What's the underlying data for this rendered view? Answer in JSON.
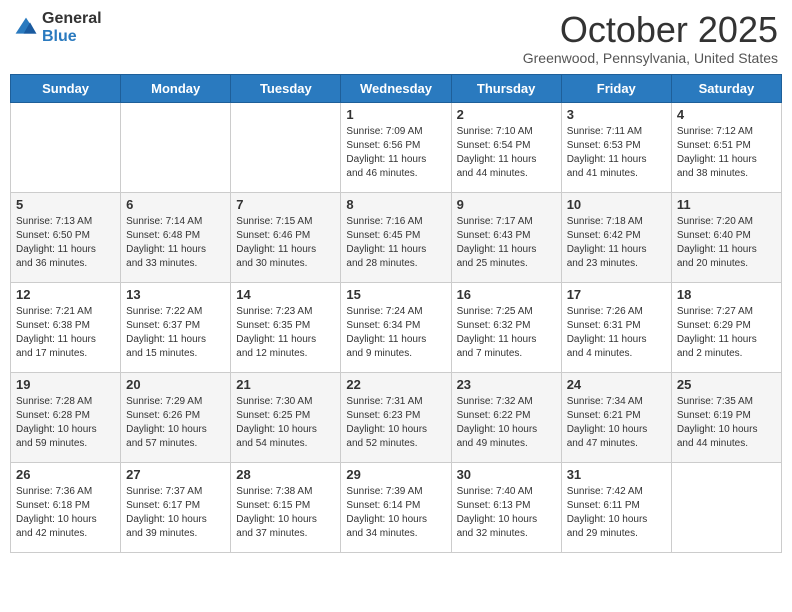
{
  "logo": {
    "general": "General",
    "blue": "Blue"
  },
  "header": {
    "title": "October 2025",
    "subtitle": "Greenwood, Pennsylvania, United States"
  },
  "days_of_week": [
    "Sunday",
    "Monday",
    "Tuesday",
    "Wednesday",
    "Thursday",
    "Friday",
    "Saturday"
  ],
  "weeks": [
    [
      {
        "day": "",
        "info": ""
      },
      {
        "day": "",
        "info": ""
      },
      {
        "day": "",
        "info": ""
      },
      {
        "day": "1",
        "info": "Sunrise: 7:09 AM\nSunset: 6:56 PM\nDaylight: 11 hours and 46 minutes."
      },
      {
        "day": "2",
        "info": "Sunrise: 7:10 AM\nSunset: 6:54 PM\nDaylight: 11 hours and 44 minutes."
      },
      {
        "day": "3",
        "info": "Sunrise: 7:11 AM\nSunset: 6:53 PM\nDaylight: 11 hours and 41 minutes."
      },
      {
        "day": "4",
        "info": "Sunrise: 7:12 AM\nSunset: 6:51 PM\nDaylight: 11 hours and 38 minutes."
      }
    ],
    [
      {
        "day": "5",
        "info": "Sunrise: 7:13 AM\nSunset: 6:50 PM\nDaylight: 11 hours and 36 minutes."
      },
      {
        "day": "6",
        "info": "Sunrise: 7:14 AM\nSunset: 6:48 PM\nDaylight: 11 hours and 33 minutes."
      },
      {
        "day": "7",
        "info": "Sunrise: 7:15 AM\nSunset: 6:46 PM\nDaylight: 11 hours and 30 minutes."
      },
      {
        "day": "8",
        "info": "Sunrise: 7:16 AM\nSunset: 6:45 PM\nDaylight: 11 hours and 28 minutes."
      },
      {
        "day": "9",
        "info": "Sunrise: 7:17 AM\nSunset: 6:43 PM\nDaylight: 11 hours and 25 minutes."
      },
      {
        "day": "10",
        "info": "Sunrise: 7:18 AM\nSunset: 6:42 PM\nDaylight: 11 hours and 23 minutes."
      },
      {
        "day": "11",
        "info": "Sunrise: 7:20 AM\nSunset: 6:40 PM\nDaylight: 11 hours and 20 minutes."
      }
    ],
    [
      {
        "day": "12",
        "info": "Sunrise: 7:21 AM\nSunset: 6:38 PM\nDaylight: 11 hours and 17 minutes."
      },
      {
        "day": "13",
        "info": "Sunrise: 7:22 AM\nSunset: 6:37 PM\nDaylight: 11 hours and 15 minutes."
      },
      {
        "day": "14",
        "info": "Sunrise: 7:23 AM\nSunset: 6:35 PM\nDaylight: 11 hours and 12 minutes."
      },
      {
        "day": "15",
        "info": "Sunrise: 7:24 AM\nSunset: 6:34 PM\nDaylight: 11 hours and 9 minutes."
      },
      {
        "day": "16",
        "info": "Sunrise: 7:25 AM\nSunset: 6:32 PM\nDaylight: 11 hours and 7 minutes."
      },
      {
        "day": "17",
        "info": "Sunrise: 7:26 AM\nSunset: 6:31 PM\nDaylight: 11 hours and 4 minutes."
      },
      {
        "day": "18",
        "info": "Sunrise: 7:27 AM\nSunset: 6:29 PM\nDaylight: 11 hours and 2 minutes."
      }
    ],
    [
      {
        "day": "19",
        "info": "Sunrise: 7:28 AM\nSunset: 6:28 PM\nDaylight: 10 hours and 59 minutes."
      },
      {
        "day": "20",
        "info": "Sunrise: 7:29 AM\nSunset: 6:26 PM\nDaylight: 10 hours and 57 minutes."
      },
      {
        "day": "21",
        "info": "Sunrise: 7:30 AM\nSunset: 6:25 PM\nDaylight: 10 hours and 54 minutes."
      },
      {
        "day": "22",
        "info": "Sunrise: 7:31 AM\nSunset: 6:23 PM\nDaylight: 10 hours and 52 minutes."
      },
      {
        "day": "23",
        "info": "Sunrise: 7:32 AM\nSunset: 6:22 PM\nDaylight: 10 hours and 49 minutes."
      },
      {
        "day": "24",
        "info": "Sunrise: 7:34 AM\nSunset: 6:21 PM\nDaylight: 10 hours and 47 minutes."
      },
      {
        "day": "25",
        "info": "Sunrise: 7:35 AM\nSunset: 6:19 PM\nDaylight: 10 hours and 44 minutes."
      }
    ],
    [
      {
        "day": "26",
        "info": "Sunrise: 7:36 AM\nSunset: 6:18 PM\nDaylight: 10 hours and 42 minutes."
      },
      {
        "day": "27",
        "info": "Sunrise: 7:37 AM\nSunset: 6:17 PM\nDaylight: 10 hours and 39 minutes."
      },
      {
        "day": "28",
        "info": "Sunrise: 7:38 AM\nSunset: 6:15 PM\nDaylight: 10 hours and 37 minutes."
      },
      {
        "day": "29",
        "info": "Sunrise: 7:39 AM\nSunset: 6:14 PM\nDaylight: 10 hours and 34 minutes."
      },
      {
        "day": "30",
        "info": "Sunrise: 7:40 AM\nSunset: 6:13 PM\nDaylight: 10 hours and 32 minutes."
      },
      {
        "day": "31",
        "info": "Sunrise: 7:42 AM\nSunset: 6:11 PM\nDaylight: 10 hours and 29 minutes."
      },
      {
        "day": "",
        "info": ""
      }
    ]
  ]
}
